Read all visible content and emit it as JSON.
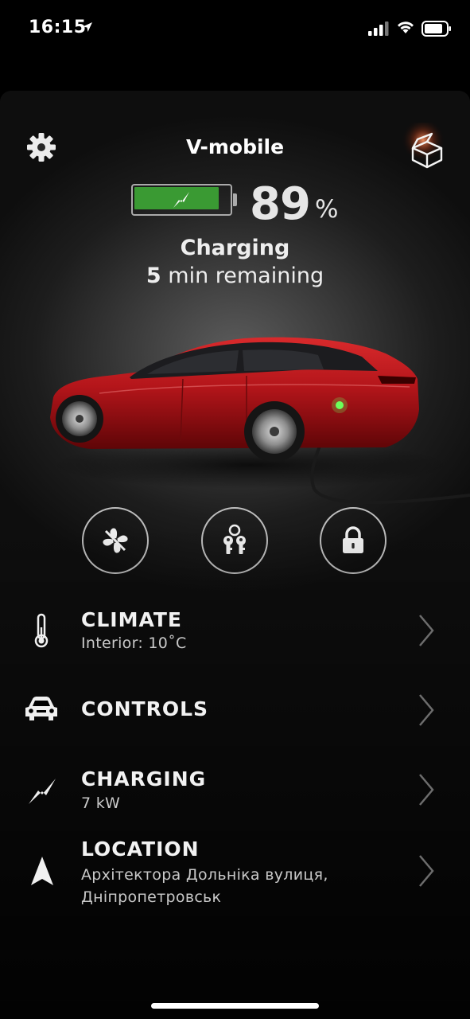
{
  "status_bar": {
    "time": "16:15"
  },
  "header": {
    "car_name": "V-mobile"
  },
  "battery": {
    "level": 0.89,
    "percent_value": "89",
    "percent_sign": "%"
  },
  "charging_status": {
    "state": "Charging",
    "minutes": "5",
    "remaining_label": "min remaining"
  },
  "quick_actions": [
    {
      "name": "climate-fan-icon"
    },
    {
      "name": "keys-icon"
    },
    {
      "name": "lock-icon"
    }
  ],
  "menu": {
    "climate": {
      "title": "CLIMATE",
      "subtitle": "Interior: 10˚C"
    },
    "controls": {
      "title": "CONTROLS"
    },
    "charging": {
      "title": "CHARGING",
      "subtitle": "7 kW"
    },
    "location": {
      "title": "LOCATION",
      "subtitle_line1": "Архітектора Дольніка вулиця,",
      "subtitle_line2": "Дніпропетровськ"
    }
  },
  "colors": {
    "battery_green": "#3a9a33",
    "car_red": "#b3151a",
    "background": "#000000"
  }
}
